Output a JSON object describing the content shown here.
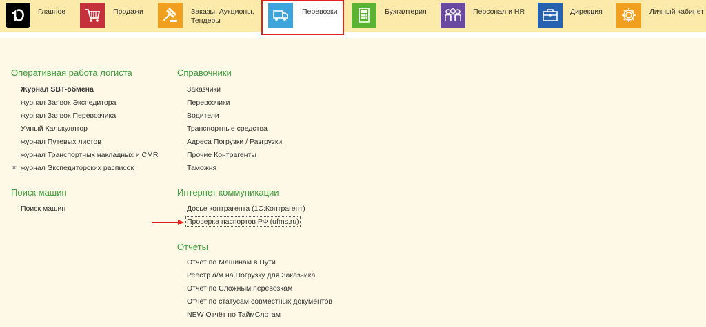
{
  "nav": {
    "items": [
      {
        "label": "Главное",
        "icon": "1c-logo-icon",
        "color": "#000000"
      },
      {
        "label": "Продажи",
        "icon": "cart-icon",
        "color": "#c4313a"
      },
      {
        "label": "Заказы,  Аукционы,",
        "label2": "Тендеры",
        "icon": "gavel-icon",
        "color": "#f0a01e"
      },
      {
        "label": "Перевозки",
        "icon": "truck-icon",
        "color": "#3ea4dc"
      },
      {
        "label": "Бухгалтерия",
        "icon": "calculator-icon",
        "color": "#5cb232"
      },
      {
        "label": "Персонал и HR",
        "icon": "people-icon",
        "color": "#6a4aa0"
      },
      {
        "label": "Дирекция",
        "icon": "briefcase-icon",
        "color": "#2762b0"
      },
      {
        "label": "Личный кабинет",
        "icon": "gear-icon",
        "color": "#f0a01e"
      }
    ]
  },
  "sections": {
    "logist": {
      "title": "Оперативная работа логиста",
      "links": [
        "Журнал SBT-обмена",
        "журнал Заявок Экспедитора",
        "журнал Заявок Перевозчика",
        "Умный Калькулятор",
        "журнал Путевых листов",
        "журнал Транспортных накладных и CMR",
        "журнал Экспедиторских расписок"
      ]
    },
    "search": {
      "title": "Поиск машин",
      "links": [
        "Поиск машин"
      ]
    },
    "refs": {
      "title": "Справочники",
      "links": [
        "Заказчики",
        "Перевозчики",
        "Водители",
        "Транспортные средства",
        "Адреса Погрузки / Разгрузки",
        "Прочие Контрагенты",
        "Таможня"
      ]
    },
    "internet": {
      "title": "Интернет коммуникации",
      "links": [
        "Досье контрагента (1С:Контрагент)",
        "Проверка паспортов РФ (ufms.ru)"
      ]
    },
    "reports": {
      "title": "Отчеты",
      "links": [
        "Отчет по Машинам в Пути",
        "Реестр а/м на Погрузку для Заказчика",
        "Отчет по Сложным перевозкам",
        "Отчет по статусам совместных документов",
        "NEW Отчёт по ТаймСлотам"
      ]
    }
  },
  "colors": {
    "accent_green": "#3a9d3a",
    "highlight_red": "#e0231c",
    "topbar": "#fbeaa9"
  }
}
